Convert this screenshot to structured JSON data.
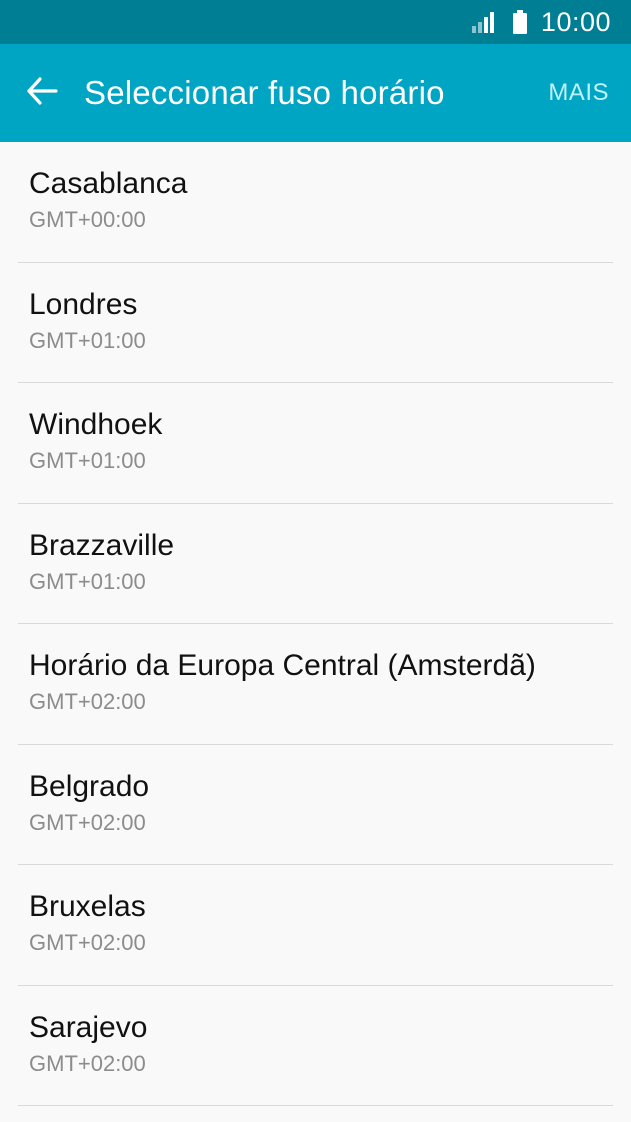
{
  "status_bar": {
    "time": "10:00",
    "icons": [
      "signal-icon",
      "battery-icon"
    ]
  },
  "app_bar": {
    "back_icon": "arrow-left-icon",
    "title": "Seleccionar fuso horário",
    "more_label": "MAIS"
  },
  "timezones": [
    {
      "name": "Casablanca",
      "offset": "GMT+00:00"
    },
    {
      "name": "Londres",
      "offset": "GMT+01:00"
    },
    {
      "name": "Windhoek",
      "offset": "GMT+01:00"
    },
    {
      "name": "Brazzaville",
      "offset": "GMT+01:00"
    },
    {
      "name": "Horário da Europa Central (Amsterdã)",
      "offset": "GMT+02:00"
    },
    {
      "name": "Belgrado",
      "offset": "GMT+02:00"
    },
    {
      "name": "Bruxelas",
      "offset": "GMT+02:00"
    },
    {
      "name": "Sarajevo",
      "offset": "GMT+02:00"
    }
  ],
  "colors": {
    "status_bar": "#007e94",
    "app_bar": "#00a5c4",
    "background": "#f9f9f9",
    "secondary_text": "#8c8c8c"
  }
}
